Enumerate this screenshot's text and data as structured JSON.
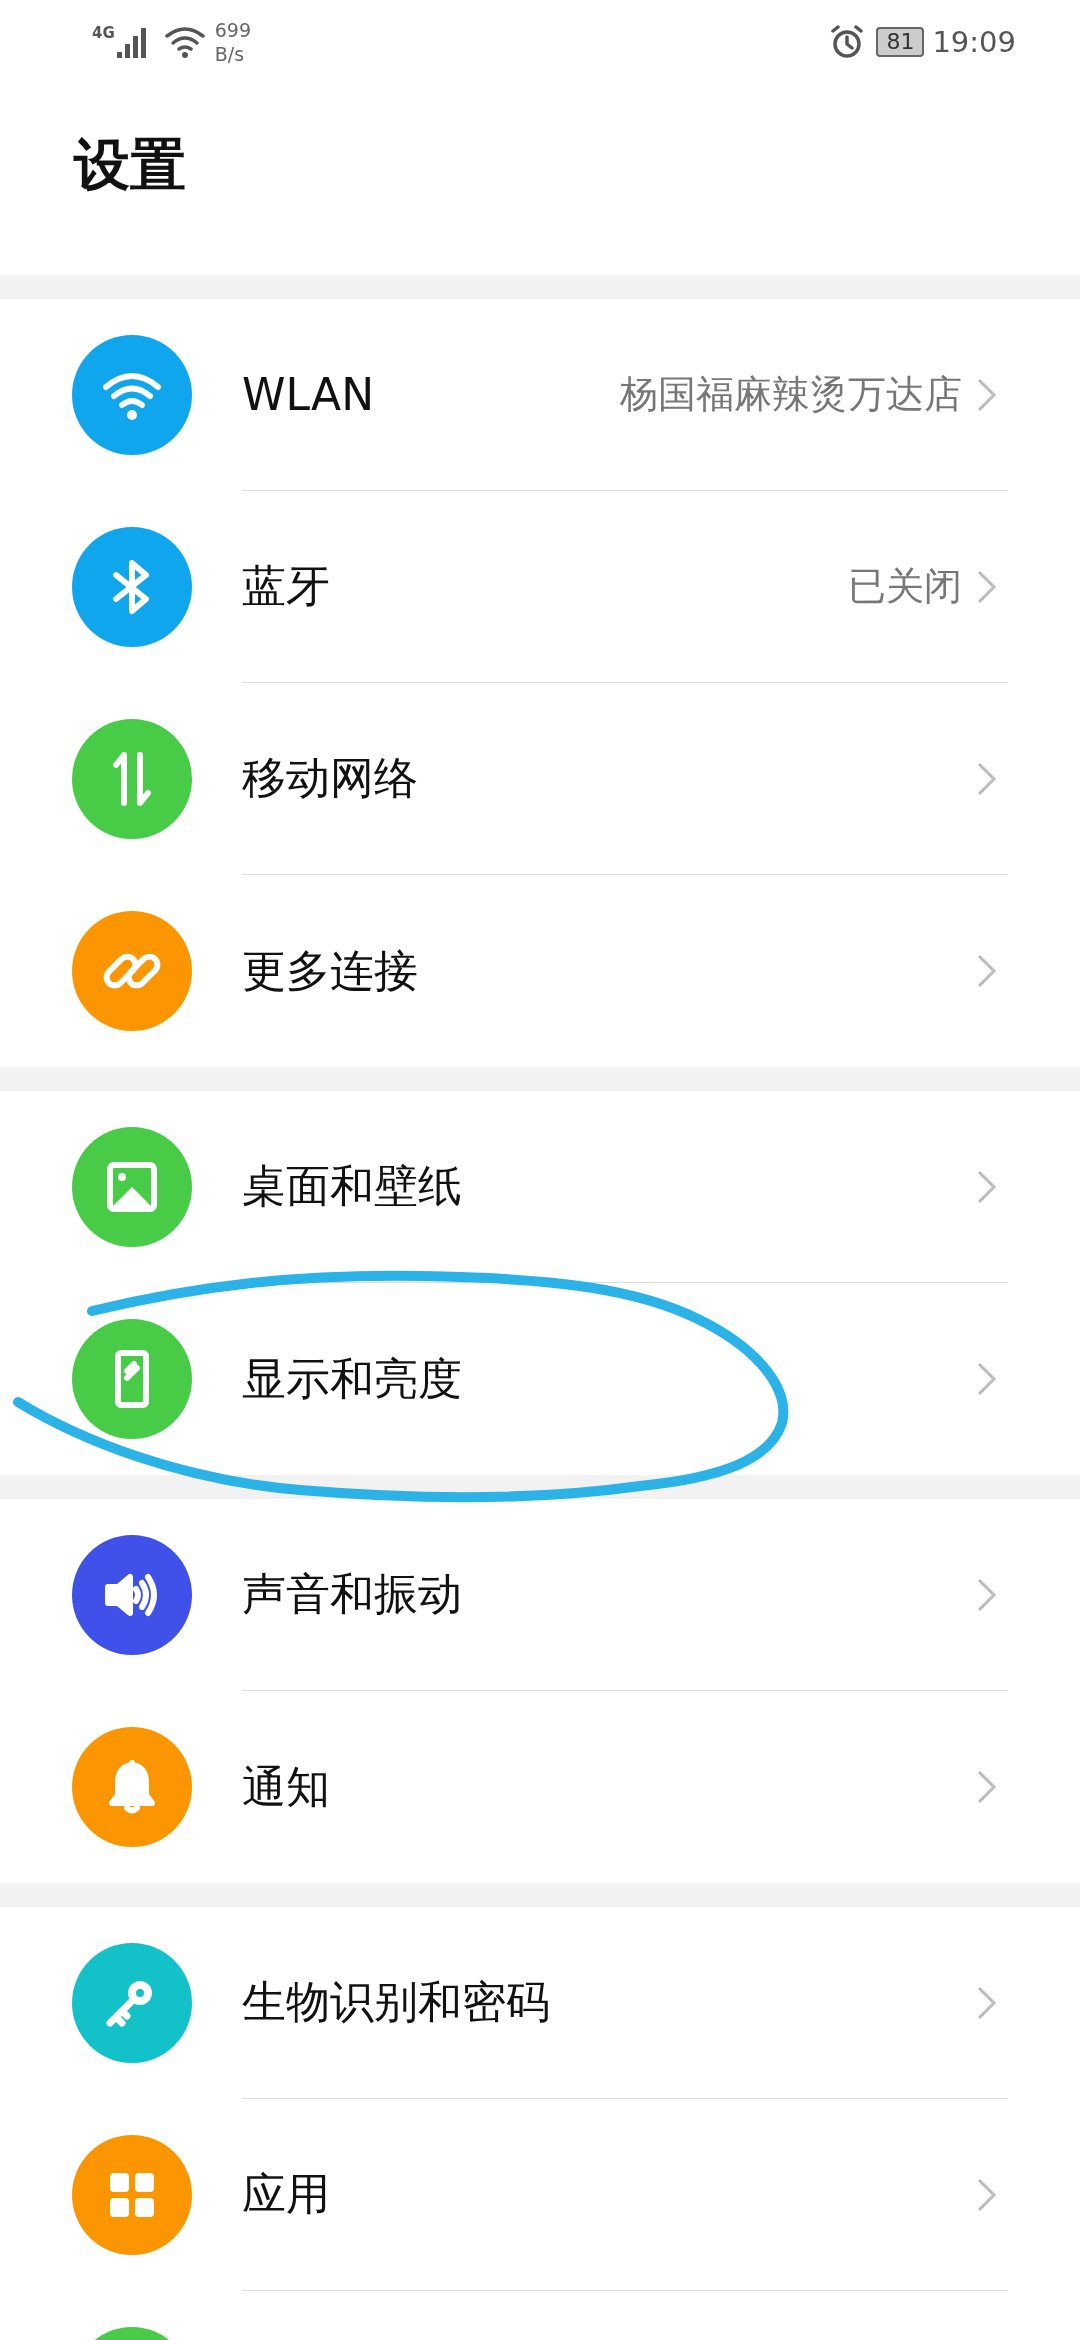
{
  "status_bar": {
    "network": "4G",
    "speed": "699",
    "speed_unit": "B/s",
    "battery": "81",
    "time": "19:09"
  },
  "title": "设置",
  "groups": [
    {
      "items": [
        {
          "label": "WLAN",
          "value": "杨国福麻辣烫万达店",
          "color": "#10a6ee"
        },
        {
          "label": "蓝牙",
          "value": "已关闭",
          "color": "#10a6ee"
        },
        {
          "label": "移动网络",
          "color": "#48cc48"
        },
        {
          "label": "更多连接",
          "color": "#fc9600"
        }
      ]
    },
    {
      "items": [
        {
          "label": "桌面和壁纸",
          "color": "#48cc48"
        },
        {
          "label": "显示和亮度",
          "color": "#48cc48"
        }
      ]
    },
    {
      "items": [
        {
          "label": "声音和振动",
          "color": "#3f51e8"
        },
        {
          "label": "通知",
          "color": "#fc9600"
        }
      ]
    },
    {
      "items": [
        {
          "label": "生物识别和密码",
          "color": "#12c2c8"
        },
        {
          "label": "应用",
          "color": "#fc9600"
        },
        {
          "color": "#48cc48"
        }
      ]
    }
  ]
}
